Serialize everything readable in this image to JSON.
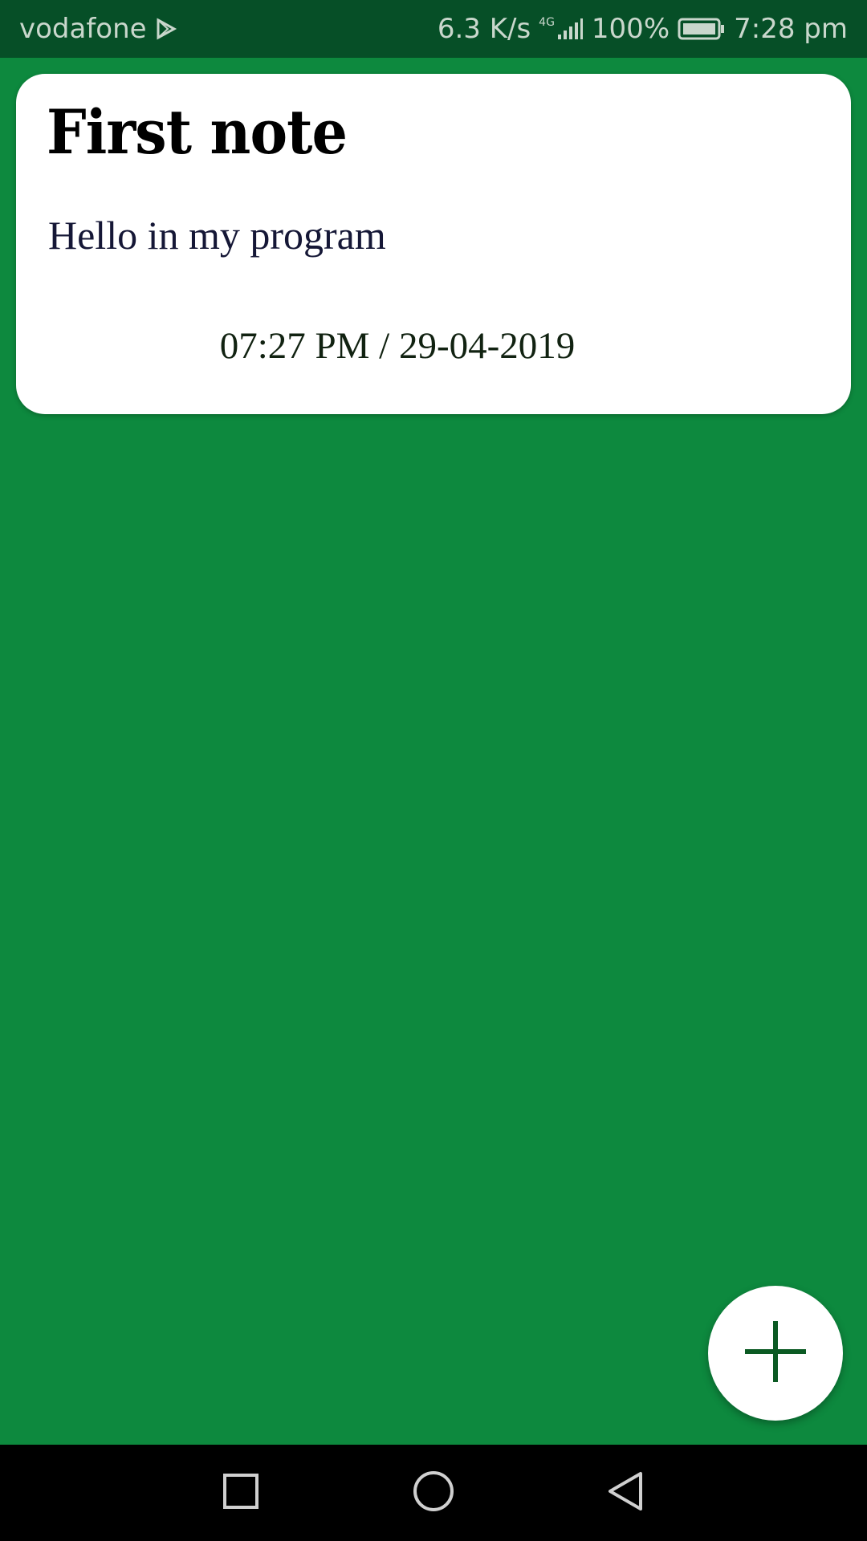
{
  "status_bar": {
    "carrier": "vodafone",
    "net_speed": "6.3 K/s",
    "network_type": "4G",
    "battery": "100%",
    "time": "7:28 pm",
    "icons": [
      "play-store-icon",
      "signal-icon",
      "battery-icon"
    ]
  },
  "notes": [
    {
      "title": "First note",
      "body": "Hello in my program",
      "timestamp": "07:27 PM / 29-04-2019"
    }
  ],
  "fab": {
    "icon": "plus-icon"
  },
  "nav_bar": {
    "icons": [
      "recents-square-icon",
      "home-circle-icon",
      "back-triangle-icon"
    ]
  },
  "colors": {
    "background": "#0d893e",
    "status_bar": "#064f27",
    "card": "#ffffff",
    "fab_icon": "#0b5a23"
  }
}
